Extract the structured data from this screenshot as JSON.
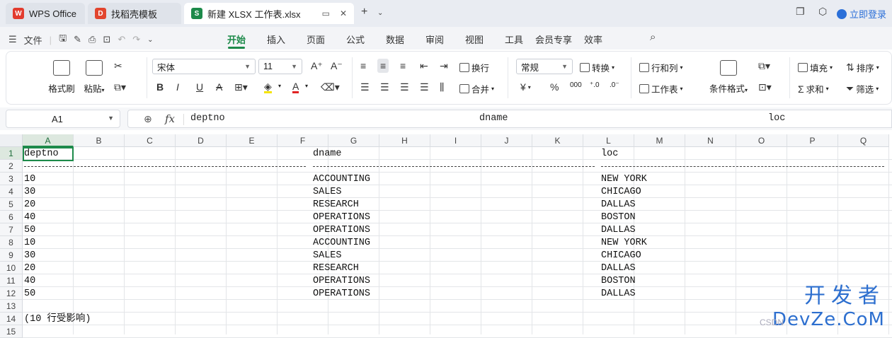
{
  "titlebar": {
    "tabs": [
      {
        "label": "WPS Office",
        "icon": "wps-icon",
        "color": "#e23b2e"
      },
      {
        "label": "找稻壳模板",
        "icon": "daoke-icon",
        "color": "#e2452e"
      },
      {
        "label": "新建 XLSX 工作表.xlsx",
        "icon": "sheet-icon",
        "color": "#1d8a4a",
        "badge": "S"
      }
    ],
    "new_tab": "+",
    "login": "立即登录"
  },
  "menu": {
    "file": "文件",
    "tabs": [
      "开始",
      "插入",
      "页面",
      "公式",
      "数据",
      "审阅",
      "视图",
      "工具",
      "会员专享",
      "效率"
    ],
    "active_tab": "开始"
  },
  "ribbon": {
    "format_painter": "格式刷",
    "paste": "粘贴",
    "font_name": "宋体",
    "font_size": "11",
    "wrap": "换行",
    "merge": "合并",
    "number_format": "常规",
    "convert": "转换",
    "rows_cols": "行和列",
    "worksheet": "工作表",
    "cond_format": "条件格式",
    "fill": "填充",
    "sort": "排序",
    "sum": "求和",
    "filter": "筛选",
    "percent": "%",
    "thousands": "000",
    "currency": "¥"
  },
  "formula_bar": {
    "cell_ref": "A1",
    "fx": "fx",
    "content_parts": [
      "deptno",
      "dname",
      "loc"
    ]
  },
  "grid": {
    "columns": [
      "A",
      "B",
      "C",
      "D",
      "E",
      "F",
      "G",
      "H",
      "I",
      "J",
      "K",
      "L",
      "M",
      "N",
      "O",
      "P",
      "Q"
    ],
    "rows": [
      "1",
      "2",
      "3",
      "4",
      "5",
      "6",
      "7",
      "8",
      "9",
      "10",
      "11",
      "12",
      "13",
      "14",
      "15"
    ],
    "header_row": {
      "deptno": "deptno",
      "dname": "dname",
      "loc": "loc"
    },
    "data": [
      {
        "deptno": "10",
        "dname": "ACCOUNTING",
        "loc": "NEW YORK"
      },
      {
        "deptno": "30",
        "dname": "SALES",
        "loc": "CHICAGO"
      },
      {
        "deptno": "20",
        "dname": "RESEARCH",
        "loc": "DALLAS"
      },
      {
        "deptno": "40",
        "dname": "OPERATIONS",
        "loc": "BOSTON"
      },
      {
        "deptno": "50",
        "dname": "OPERATIONS",
        "loc": "DALLAS"
      },
      {
        "deptno": "10",
        "dname": "ACCOUNTING",
        "loc": "NEW YORK"
      },
      {
        "deptno": "30",
        "dname": "SALES",
        "loc": "CHICAGO"
      },
      {
        "deptno": "20",
        "dname": "RESEARCH",
        "loc": "DALLAS"
      },
      {
        "deptno": "40",
        "dname": "OPERATIONS",
        "loc": "BOSTON"
      },
      {
        "deptno": "50",
        "dname": "OPERATIONS",
        "loc": "DALLAS"
      }
    ],
    "footer": "(10 行受影响)"
  },
  "watermark": {
    "line1": "开发者",
    "line2": "DevZe.CoM",
    "faint": "CSDN"
  },
  "colors": {
    "accent": "#1d8a4a",
    "brand": "#2b6fd8"
  }
}
